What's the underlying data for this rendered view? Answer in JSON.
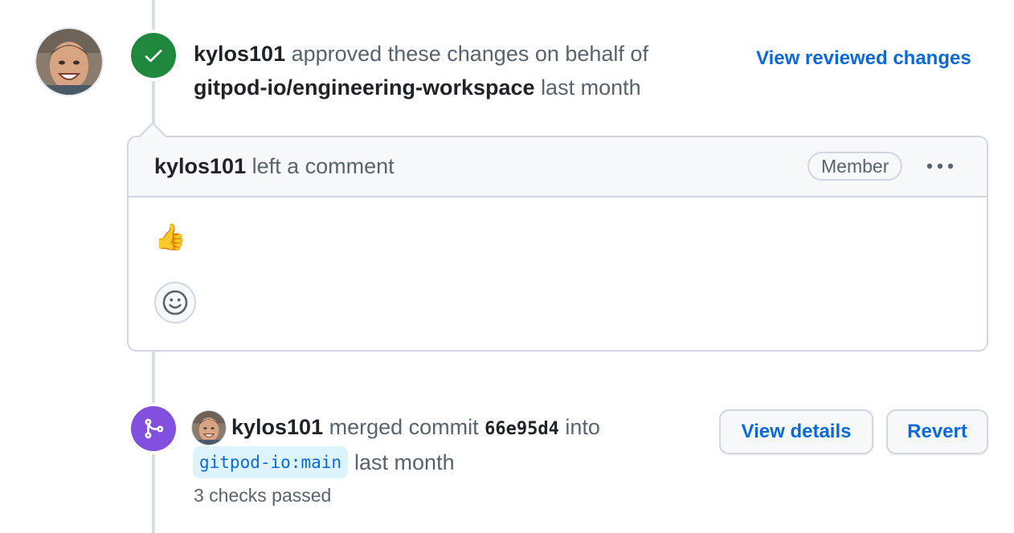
{
  "review_event": {
    "user": "kylos101",
    "action": "approved these changes on behalf of",
    "team": "gitpod-io/engineering-workspace",
    "time": "last month",
    "view_link": "View reviewed changes",
    "badge_icon": "check-icon"
  },
  "comment": {
    "author": "kylos101",
    "action": "left a comment",
    "role_badge": "Member",
    "menu_icon": "kebab-horizontal-icon",
    "body": "👍",
    "reaction_icon": "smiley-icon"
  },
  "merge_event": {
    "user": "kylos101",
    "action": "merged commit",
    "commit": "66e95d4",
    "into": "into",
    "branch_owner": "gitpod-io",
    "branch_sep": ":",
    "branch_name": "main",
    "time": "last month",
    "checks": "3 checks passed",
    "details_button": "View details",
    "revert_button": "Revert",
    "badge_icon": "git-merge-icon"
  },
  "colors": {
    "approved": "#1f883d",
    "merged": "#8250df",
    "link": "#0969da"
  }
}
